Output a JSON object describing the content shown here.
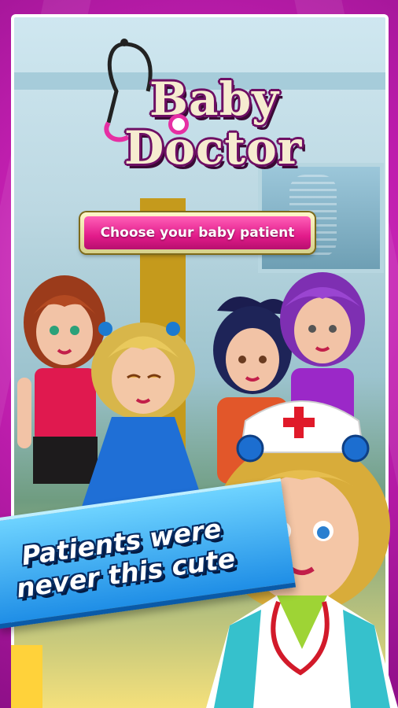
{
  "logo": {
    "line1": "Baby",
    "line2": "Doctor"
  },
  "choose_button": {
    "label": "Choose your baby patient"
  },
  "tagline": {
    "line1": "Patients were",
    "line2": "never this cute"
  },
  "colors": {
    "background": "#c21fb0",
    "button": "#e21b8a",
    "banner": "#1f8ee6",
    "logo_text": "#f6ecd0"
  },
  "characters": [
    {
      "name": "patient-girl-red-hair",
      "outfit": "pink top and black skirt"
    },
    {
      "name": "patient-girl-blonde-sleeping",
      "outfit": "blue dress"
    },
    {
      "name": "patient-girl-black-hair",
      "outfit": "orange top"
    },
    {
      "name": "patient-girl-purple-hair",
      "outfit": "purple dress"
    },
    {
      "name": "nurse-girl-blonde",
      "outfit": "white coat, nurse cap, stethoscope"
    }
  ]
}
